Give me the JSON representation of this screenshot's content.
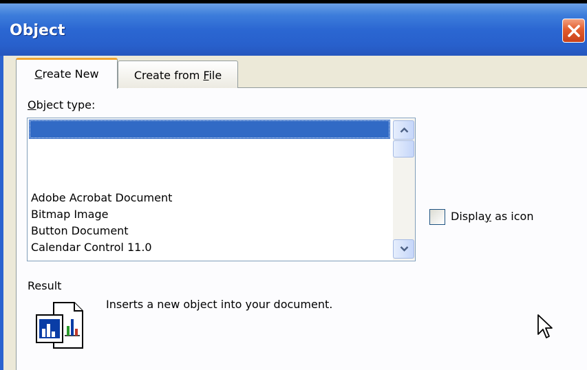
{
  "dialog": {
    "title": "Object",
    "close_icon": "close-x-icon"
  },
  "tabs": [
    {
      "label": "Create New",
      "active": true,
      "mnemonic": "C"
    },
    {
      "label": "Create from File",
      "active": false,
      "mnemonic": "F"
    }
  ],
  "object_type": {
    "label": "Object type:",
    "selected_index": 0,
    "items": [
      "",
      "Adobe Acrobat Document",
      "Bitmap Image",
      "Button Document",
      "Calendar Control 11.0"
    ]
  },
  "display_as_icon": {
    "label": "Display as icon",
    "checked": false
  },
  "result": {
    "label": "Result",
    "description": "Inserts a new  object into your document.",
    "icon": "embedded-object-chart-icon"
  },
  "colors": {
    "titlebar": "#2b67d2",
    "selection": "#316ac5",
    "close_button": "#e35d2d",
    "active_tab_highlight": "#f0a530"
  }
}
